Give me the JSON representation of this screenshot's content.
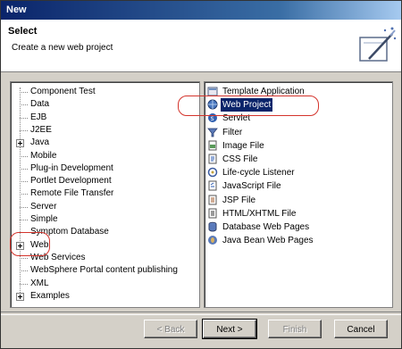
{
  "window": {
    "title": "New"
  },
  "banner": {
    "heading": "Select",
    "subtitle": "Create a new web project",
    "icon": "new-wizard-icon"
  },
  "wizard_tree": {
    "items": [
      {
        "label": "Component Test",
        "expandable": false
      },
      {
        "label": "Data",
        "expandable": false
      },
      {
        "label": "EJB",
        "expandable": false
      },
      {
        "label": "J2EE",
        "expandable": false
      },
      {
        "label": "Java",
        "expandable": true
      },
      {
        "label": "Mobile",
        "expandable": false
      },
      {
        "label": "Plug-in Development",
        "expandable": false
      },
      {
        "label": "Portlet Development",
        "expandable": false
      },
      {
        "label": "Remote File Transfer",
        "expandable": false
      },
      {
        "label": "Server",
        "expandable": false
      },
      {
        "label": "Simple",
        "expandable": false
      },
      {
        "label": "Symptom Database",
        "expandable": false
      },
      {
        "label": "Web",
        "expandable": true,
        "selected": true
      },
      {
        "label": "Web Services",
        "expandable": false
      },
      {
        "label": "WebSphere Portal content publishing",
        "expandable": false
      },
      {
        "label": "XML",
        "expandable": false
      },
      {
        "label": "Examples",
        "expandable": true
      }
    ]
  },
  "wizard_list": {
    "items": [
      {
        "label": "Template Application",
        "icon": "template-icon"
      },
      {
        "label": "Web Project",
        "icon": "web-project-icon",
        "selected": true
      },
      {
        "label": "Servlet",
        "icon": "servlet-icon"
      },
      {
        "label": "Filter",
        "icon": "filter-icon"
      },
      {
        "label": "Image File",
        "icon": "image-file-icon"
      },
      {
        "label": "CSS File",
        "icon": "css-file-icon"
      },
      {
        "label": "Life-cycle Listener",
        "icon": "listener-icon"
      },
      {
        "label": "JavaScript File",
        "icon": "javascript-file-icon"
      },
      {
        "label": "JSP File",
        "icon": "jsp-file-icon"
      },
      {
        "label": "HTML/XHTML File",
        "icon": "html-file-icon"
      },
      {
        "label": "Database Web Pages",
        "icon": "database-web-pages-icon"
      },
      {
        "label": "Java Bean Web Pages",
        "icon": "java-bean-web-pages-icon"
      }
    ]
  },
  "buttons": {
    "back": "< Back",
    "next": "Next >",
    "finish": "Finish",
    "cancel": "Cancel"
  },
  "colors": {
    "selection": "#0a246a",
    "annotation": "#d4342c"
  }
}
